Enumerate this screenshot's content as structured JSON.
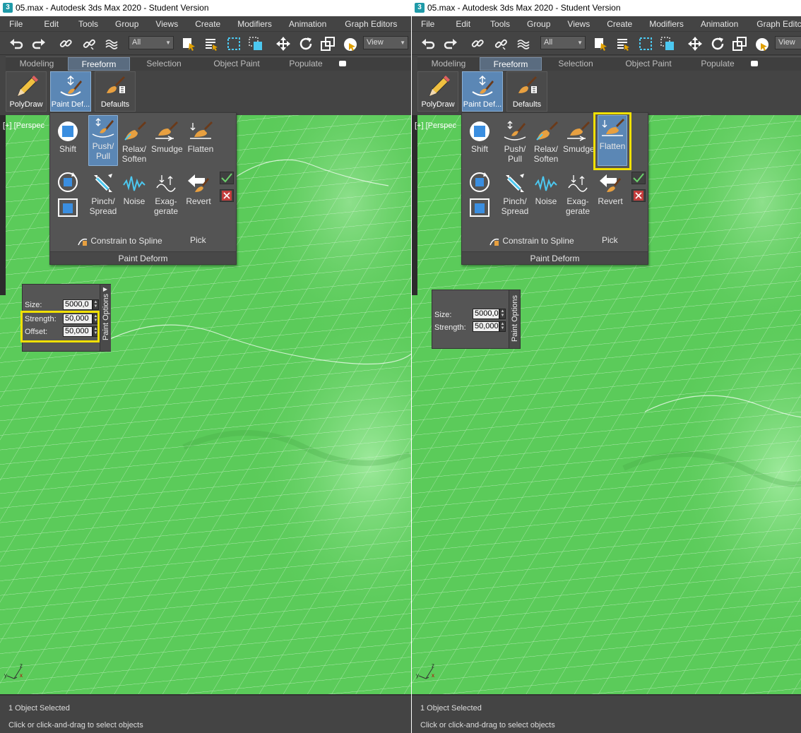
{
  "window": {
    "title": "05.max - Autodesk 3ds Max 2020 - Student Version",
    "icon_name": "3ds-max-app-icon"
  },
  "menu": [
    "File",
    "Edit",
    "Tools",
    "Group",
    "Views",
    "Create",
    "Modifiers",
    "Animation",
    "Graph Editors"
  ],
  "menu_right": [
    "File",
    "Edit",
    "Tools",
    "Group",
    "Views",
    "Create",
    "Modifiers",
    "Animation",
    "Graph Editc"
  ],
  "toolbar": {
    "selection_filter": "All",
    "reference_coord": "View"
  },
  "ribbon": {
    "tabs": [
      "Modeling",
      "Freeform",
      "Selection",
      "Object Paint",
      "Populate"
    ],
    "active_tab": "Freeform",
    "buttons": [
      "PolyDraw",
      "Paint Def...",
      "Defaults"
    ]
  },
  "viewport": {
    "label": "[+] [Perspec",
    "background_color": "#5bcb5a",
    "axis": {
      "x": "x",
      "y": "y",
      "z": "z"
    }
  },
  "paint_deform": {
    "tools_row1": [
      "Shift",
      "Push/ Pull",
      "Relax/ Soften",
      "Smudge",
      "Flatten"
    ],
    "tools_row2": [
      "Pinch/ Spread",
      "Noise",
      "Exag- gerate",
      "Revert"
    ],
    "constrain": "Constrain to Spline",
    "pick": "Pick",
    "title": "Paint Deform"
  },
  "left": {
    "active_tool": "Push/ Pull",
    "paint_options": {
      "title": "Paint Options",
      "size_label": "Size:",
      "size_value": "5000,0",
      "strength_label": "Strength:",
      "strength_value": "50,000",
      "offset_label": "Offset:",
      "offset_value": "50,000"
    }
  },
  "right": {
    "active_tool": "Flatten",
    "paint_options": {
      "title": "Paint Options",
      "size_label": "Size:",
      "size_value": "5000,0",
      "strength_label": "Strength:",
      "strength_value": "50,000"
    }
  },
  "status": {
    "line1": "1 Object Selected",
    "line2": "Click or click-and-drag to select objects"
  },
  "highlight_color": "#f0e000"
}
